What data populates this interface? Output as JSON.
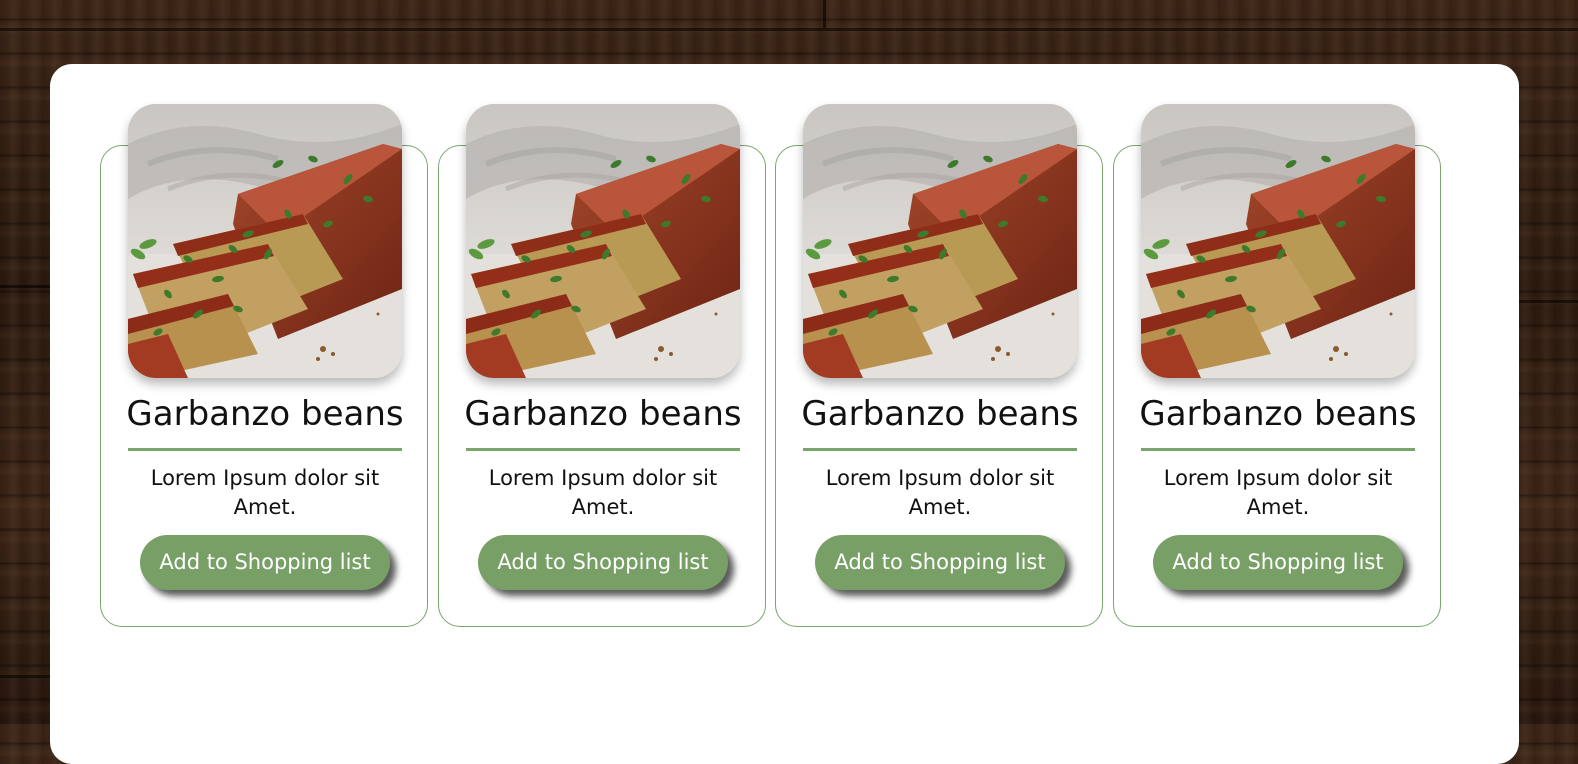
{
  "palette": {
    "accent_green": "#78a066",
    "border_green": "#7aa66e",
    "panel_bg": "#ffffff",
    "wood_bg": "#2b190f"
  },
  "products": [
    {
      "title": "Garbanzo beans",
      "description": "Lorem Ipsum dolor sit Amet.",
      "button_label": "Add to Shopping list",
      "image_icon": "meatloaf-photo"
    },
    {
      "title": "Garbanzo beans",
      "description": "Lorem Ipsum dolor sit Amet.",
      "button_label": "Add to Shopping list",
      "image_icon": "meatloaf-photo"
    },
    {
      "title": "Garbanzo beans",
      "description": "Lorem Ipsum dolor sit Amet.",
      "button_label": "Add to Shopping list",
      "image_icon": "meatloaf-photo"
    },
    {
      "title": "Garbanzo beans",
      "description": "Lorem Ipsum dolor sit Amet.",
      "button_label": "Add to Shopping list",
      "image_icon": "meatloaf-photo"
    }
  ]
}
